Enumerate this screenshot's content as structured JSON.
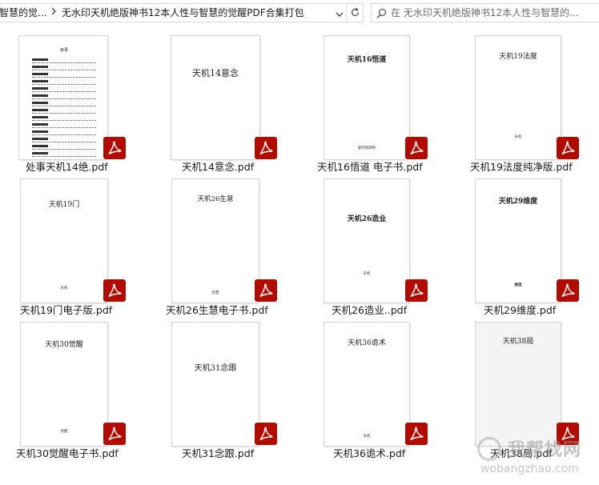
{
  "breadcrumb": {
    "parent": "智慧的觉...",
    "current": "无水印天机绝版神书12本人性与智慧的觉醒PDF合集打包"
  },
  "search": {
    "placeholder": "在 无水印天机绝版神书12本人性与智慧的..."
  },
  "colors": {
    "pdf_red": "#b30b00",
    "thumb_border": "#d4d4d4"
  },
  "files": [
    {
      "name": "处事天机14绝.pdf",
      "thumb_title": "",
      "thumb_sub": "",
      "thumb_toc_head": "目录"
    },
    {
      "name": "天机14意念.pdf",
      "thumb_title": "天机14意念",
      "thumb_sub": ""
    },
    {
      "name": "天机16悟道 电子书.pdf",
      "thumb_title": "天机16悟道",
      "thumb_sub": "掌控和转移"
    },
    {
      "name": "天机19法度纯净版.pdf",
      "thumb_title": "天机19法度",
      "thumb_sub": "天机"
    },
    {
      "name": "天机19门电子版.pdf",
      "thumb_title": "天机19门",
      "thumb_sub": "天机"
    },
    {
      "name": "天机26生慧电子书.pdf",
      "thumb_title": "天机26生慧",
      "thumb_sub": "智慧"
    },
    {
      "name": "天机26造业..pdf",
      "thumb_title": "天机26造业",
      "thumb_sub": "天机"
    },
    {
      "name": "天机29维度.pdf",
      "thumb_title": "天机29维度",
      "thumb_sub": "维度"
    },
    {
      "name": "天机30觉醒电子书.pdf",
      "thumb_title": "天机30觉醒",
      "thumb_sub": "觉醒"
    },
    {
      "name": "天机31念跟.pdf",
      "thumb_title": "天机31念跟",
      "thumb_sub": ""
    },
    {
      "name": "天机36诡术.pdf",
      "thumb_title": "天机36诡术",
      "thumb_sub": "天机"
    },
    {
      "name": "天机38局.pdf",
      "thumb_title": "天机38局",
      "thumb_sub": ""
    }
  ],
  "watermark": {
    "cn": "我帮找网",
    "en": "wobangzhao.com"
  }
}
